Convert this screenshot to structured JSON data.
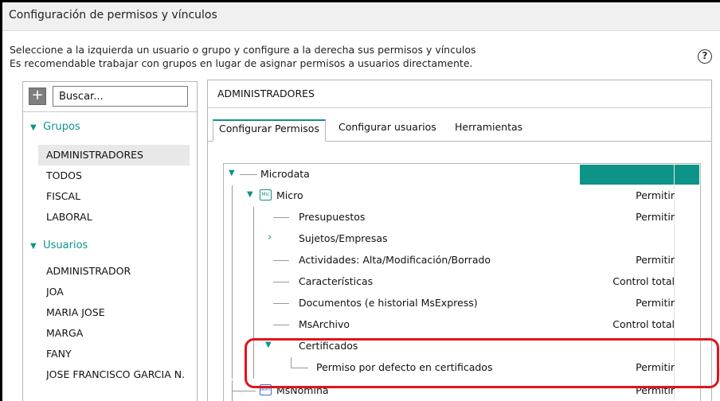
{
  "window": {
    "title": "Configuración de permisos y vínculos"
  },
  "description": {
    "line1": "Seleccione a la izquierda un usuario o grupo y configure a la derecha sus permisos y vínculos",
    "line2": "Es recomendable trabajar con grupos en lugar de asignar permisos a usuarios directamente."
  },
  "help_icon": "?",
  "left": {
    "add_label": "+",
    "search_value": "Buscar...",
    "groups_header": "Grupos",
    "groups": [
      "ADMINISTRADORES",
      "TODOS",
      "FISCAL",
      "LABORAL"
    ],
    "users_header": "Usuarios",
    "users": [
      "ADMINISTRADOR",
      "JOA",
      "MARIA JOSE",
      "MARGA",
      "FANY",
      "JOSE FRANCISCO GARCIA N."
    ],
    "selected": "ADMINISTRADORES"
  },
  "right": {
    "title": "ADMINISTRADORES",
    "tabs": [
      "Configurar Permisos",
      "Configurar usuarios",
      "Herramientas"
    ],
    "active_tab": "Configurar Permisos"
  },
  "tree": {
    "root": "Microdata",
    "micro": {
      "label": "Micro",
      "icon": "Mic",
      "perm": "Permitir"
    },
    "items": [
      {
        "label": "Presupuestos",
        "perm": "Permitir"
      },
      {
        "label": "Sujetos/Empresas",
        "perm": ""
      },
      {
        "label": "Actividades: Alta/Modificación/Borrado",
        "perm": "Permitir"
      },
      {
        "label": "Características",
        "perm": "Control total"
      },
      {
        "label": "Documentos (e historial MsExpress)",
        "perm": "Permitir"
      },
      {
        "label": "MsArchivo",
        "perm": "Control total"
      },
      {
        "label": "Certificados",
        "perm": ""
      },
      {
        "label": "Permiso por defecto en certificados",
        "perm": "Permitir"
      }
    ],
    "msnomina": {
      "label": "MsNomina",
      "icon": "Nom",
      "perm": "Permitir"
    }
  },
  "colors": {
    "accent": "#0d9488",
    "highlight": "#e0141e"
  }
}
